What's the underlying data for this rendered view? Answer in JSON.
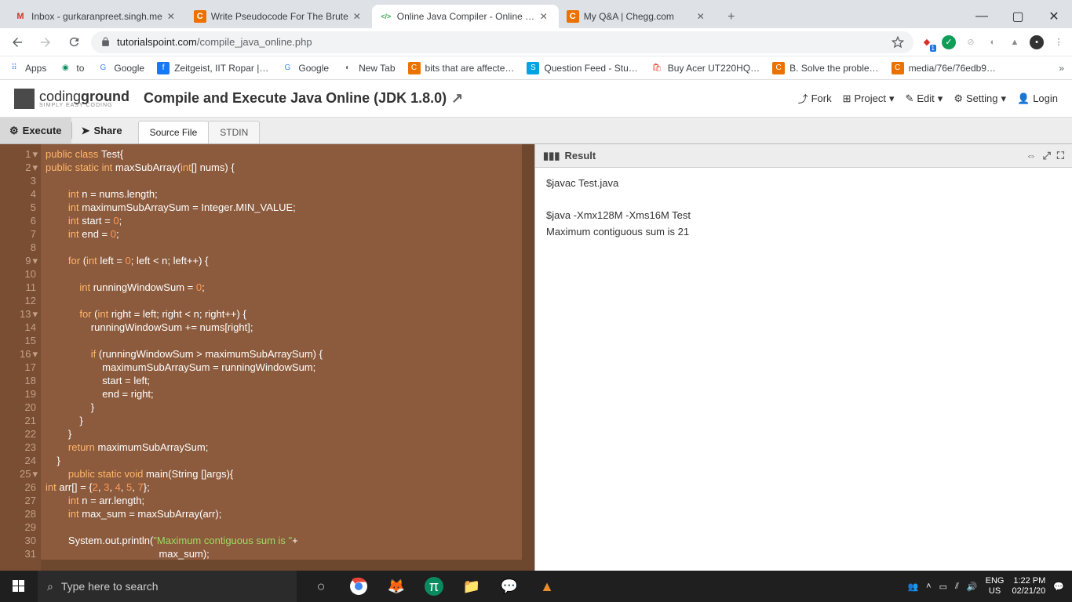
{
  "browser": {
    "tabs": [
      {
        "label": "Inbox - gurkaranpreet.singh.me",
        "fav": "M",
        "favcolor": "#d93025"
      },
      {
        "label": "Write Pseudocode For The Brute",
        "fav": "C",
        "favcolor": "#eb7100"
      },
      {
        "label": "Online Java Compiler - Online Ja",
        "fav": "</>",
        "favcolor": "#3eab53",
        "active": true
      },
      {
        "label": "My Q&A | Chegg.com",
        "fav": "C",
        "favcolor": "#eb7100"
      }
    ],
    "url_domain": "tutorialspoint.com",
    "url_path": "/compile_java_online.php"
  },
  "bookmarks": [
    {
      "label": "Apps",
      "ico": "⋮⋮⋮"
    },
    {
      "label": "to",
      "ico": "●",
      "color": "#0a8a5f"
    },
    {
      "label": "Google",
      "ico": "G",
      "color": "#4285F4"
    },
    {
      "label": "Zeitgeist, IIT Ropar |…",
      "ico": "f",
      "color": "#1877F2"
    },
    {
      "label": "Google",
      "ico": "G",
      "color": "#4285F4"
    },
    {
      "label": "New Tab",
      "ico": "◐",
      "color": "#5f6368"
    },
    {
      "label": "bits that are affecte…",
      "ico": "C",
      "color": "#eb7100"
    },
    {
      "label": "Question Feed - Stu…",
      "ico": "S",
      "color": "#00a4e4"
    },
    {
      "label": "Buy Acer UT220HQ…",
      "ico": "🛍",
      "color": "#ea4335"
    },
    {
      "label": "B. Solve the proble…",
      "ico": "C",
      "color": "#eb7100"
    },
    {
      "label": "media/76e/76edb9…",
      "ico": "C",
      "color": "#eb7100"
    }
  ],
  "page": {
    "logo1": "coding",
    "logo2": "ground",
    "logo_sub": "SIMPLY EASY CODING",
    "title": "Compile and Execute Java Online (JDK 1.8.0)",
    "actions": {
      "fork": "Fork",
      "project": "Project",
      "edit": "Edit",
      "setting": "Setting",
      "login": "Login"
    }
  },
  "toolbar": {
    "execute": "Execute",
    "share": "Share",
    "tab1": "Source File",
    "tab2": "STDIN"
  },
  "editor": {
    "lines": [
      "1",
      "2",
      "3",
      "4",
      "5",
      "6",
      "7",
      "8",
      "9",
      "10",
      "11",
      "12",
      "13",
      "14",
      "15",
      "16",
      "17",
      "18",
      "19",
      "20",
      "21",
      "22",
      "23",
      "24",
      "25",
      "26",
      "27",
      "28",
      "29",
      "30",
      "31"
    ]
  },
  "result": {
    "title": "Result",
    "out1": "$javac Test.java",
    "out2": "$java -Xmx128M -Xms16M Test",
    "out3": "Maximum contiguous sum is 21"
  },
  "taskbar": {
    "search_ph": "Type here to search",
    "lang1": "ENG",
    "lang2": "US",
    "time": "1:22 PM",
    "date": "02/21/20"
  }
}
